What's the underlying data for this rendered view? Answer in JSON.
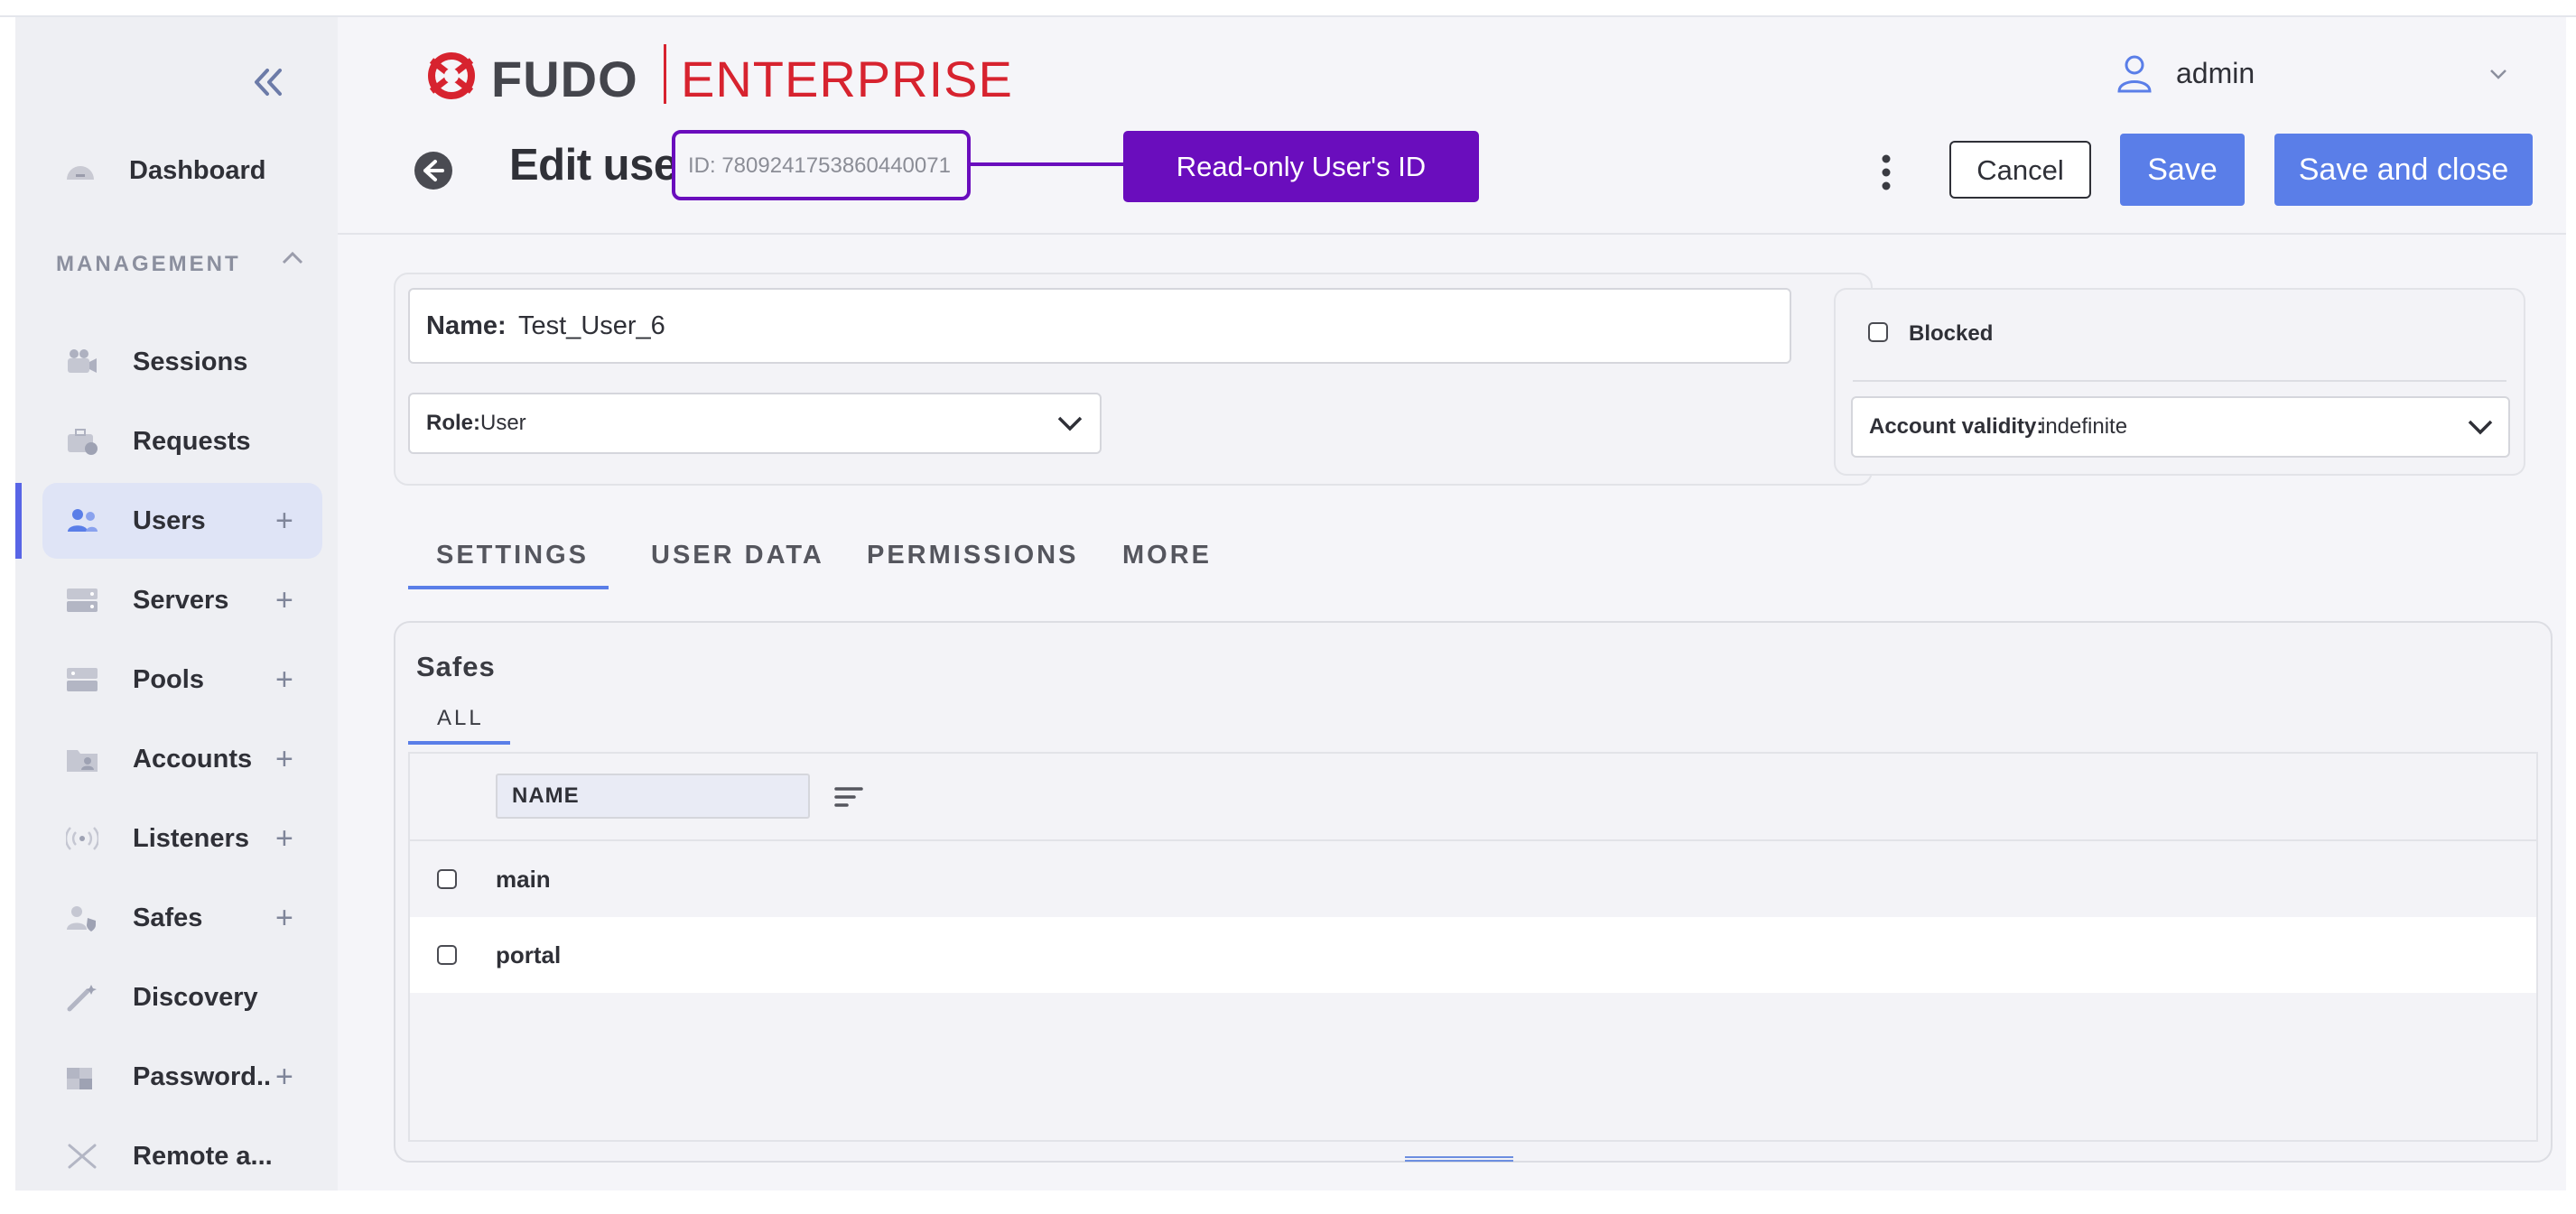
{
  "sidebar": {
    "collapse_icon": "double-chevron-left-icon",
    "dashboard": {
      "label": "Dashboard",
      "icon": "dashboard-gauge-icon"
    },
    "section_label": "MANAGEMENT",
    "items": [
      {
        "label": "Sessions",
        "icon": "video-camera-icon",
        "plus": ""
      },
      {
        "label": "Requests",
        "icon": "briefcase-clock-icon",
        "plus": ""
      },
      {
        "label": "Users",
        "icon": "users-icon",
        "plus": "+",
        "active": true
      },
      {
        "label": "Servers",
        "icon": "server-icon",
        "plus": "+"
      },
      {
        "label": "Pools",
        "icon": "server-pool-icon",
        "plus": "+"
      },
      {
        "label": "Accounts",
        "icon": "folder-user-icon",
        "plus": "+"
      },
      {
        "label": "Listeners",
        "icon": "broadcast-icon",
        "plus": "+"
      },
      {
        "label": "Safes",
        "icon": "user-shield-icon",
        "plus": "+"
      },
      {
        "label": "Discovery",
        "icon": "magic-wand-icon",
        "plus": ""
      },
      {
        "label": "Password..",
        "icon": "puzzle-key-icon",
        "plus": "+"
      },
      {
        "label": "Remote a...",
        "icon": "tools-cross-icon",
        "plus": ""
      }
    ]
  },
  "header": {
    "logo_text": "FUDO",
    "logo_suffix": "ENTERPRISE",
    "user": {
      "name": "admin",
      "icon": "user-icon"
    },
    "page_title": "Edit user",
    "user_id": "ID: 7809241753860440071",
    "callout": "Read-only User's ID",
    "buttons": {
      "cancel": "Cancel",
      "save": "Save",
      "save_close": "Save and close"
    }
  },
  "form": {
    "name_label": "Name:",
    "name_value": "Test_User_6",
    "role_label": "Role:",
    "role_value": "User",
    "blocked_label": "Blocked",
    "validity_label": "Account validity:",
    "validity_value": "indefinite"
  },
  "tabs": [
    "SETTINGS",
    "USER DATA",
    "PERMISSIONS",
    "MORE"
  ],
  "safes": {
    "title": "Safes",
    "subtab": "ALL",
    "column": "NAME",
    "rows": [
      "main",
      "portal"
    ]
  },
  "colors": {
    "accent": "#5a7ee8",
    "callout": "#6a0dbd",
    "brand_red": "#d7232f"
  }
}
